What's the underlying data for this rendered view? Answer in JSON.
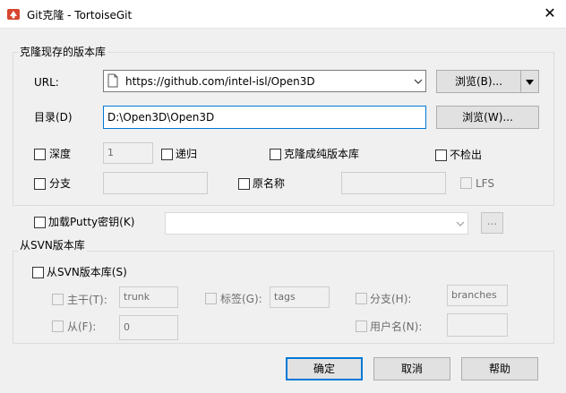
{
  "window": {
    "title": "Git克隆 - TortoiseGit",
    "close_glyph": "✕",
    "icon": "tortoisegit-app-icon"
  },
  "clone_group": {
    "title": "克隆现存的版本库",
    "url_label": "URL:",
    "url_value": "https://github.com/intel-isl/Open3D",
    "url_browse": "浏览(B)...",
    "dir_label": "目录(D)",
    "dir_value": "D:\\Open3D\\Open3D",
    "dir_browse": "浏览(W)...",
    "depth_label": "深度",
    "depth_value": "1",
    "recursive_label": "递归",
    "bare_label": "克隆成纯版本库",
    "no_checkout_label": "不检出",
    "branch_label": "分支",
    "branch_value": "",
    "origin_label": "原名称",
    "origin_value": "",
    "lfs_label": "LFS"
  },
  "putty": {
    "label": "加载Putty密钥(K)",
    "value": "",
    "browse": "..."
  },
  "svn_group": {
    "title": "从SVN版本库",
    "from_svn_label": "从SVN版本库(S)",
    "trunk_label": "主干(T):",
    "trunk_value": "trunk",
    "tags_label": "标签(G):",
    "tags_value": "tags",
    "branches_label": "分支(H):",
    "branches_value": "branches",
    "from_label": "从(F):",
    "from_value": "0",
    "username_label": "用户名(N):",
    "username_value": ""
  },
  "buttons": {
    "ok": "确定",
    "cancel": "取消",
    "help": "帮助"
  }
}
